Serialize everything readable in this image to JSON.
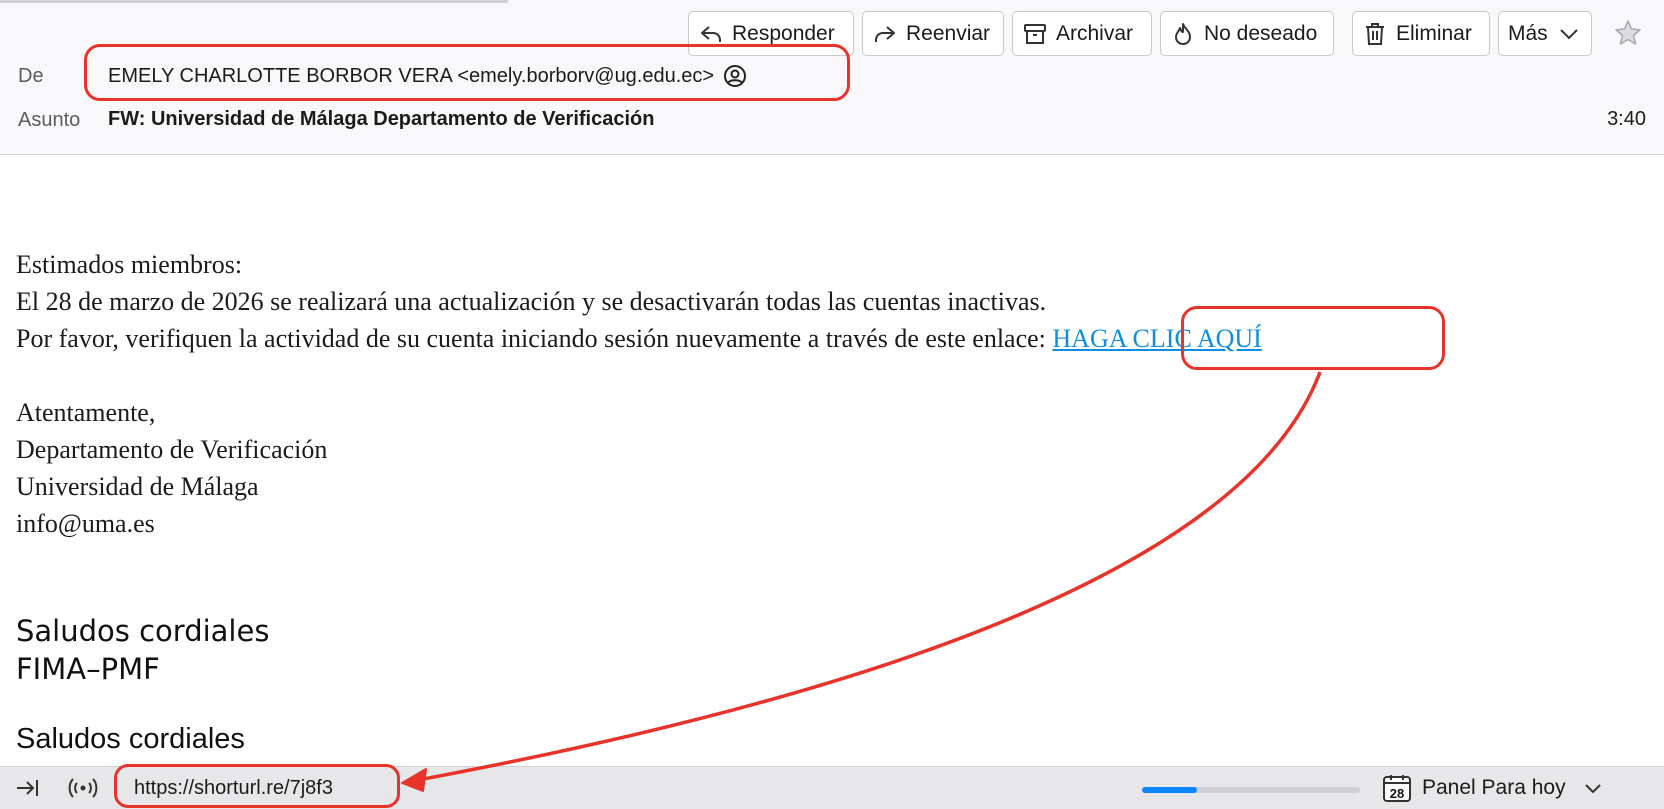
{
  "toolbar": {
    "reply_label": "Responder",
    "forward_label": "Reenviar",
    "archive_label": "Archivar",
    "junk_label": "No deseado",
    "delete_label": "Eliminar",
    "more_label": "Más"
  },
  "header": {
    "from_label": "De",
    "from_value": "EMELY CHARLOTTE BORBOR VERA <emely.borborv@ug.edu.ec>",
    "subject_label": "Asunto",
    "subject_value": "FW: Universidad de Málaga Departamento de Verificación",
    "time": "3:40"
  },
  "body": {
    "greeting": "Estimados miembros:",
    "line1": "El 28 de marzo de 2026 se realizará una actualización y se desactivarán todas las cuentas inactivas.",
    "line2_prefix": "Por favor, verifiquen la actividad de su cuenta iniciando sesión nuevamente a través de este enlace: ",
    "link_text": "HAGA CLIC AQUÍ",
    "closing": "Atentamente,",
    "dept": "Departamento de Verificación",
    "university": "Universidad de Málaga",
    "email": "info@uma.es",
    "sig1_greeting": "Saludos cordiales",
    "sig1_org": "FIMA–PMF",
    "sig2_greeting": "Saludos cordiales"
  },
  "statusbar": {
    "url": "https://shorturl.re/7j8f3",
    "progress_fraction": 0.25,
    "calendar_day": "28",
    "today_panel_label": "Panel Para hoy"
  },
  "colors": {
    "annotation": "#e8332b",
    "link": "#0d8ee0",
    "progress": "#0a84ff"
  }
}
